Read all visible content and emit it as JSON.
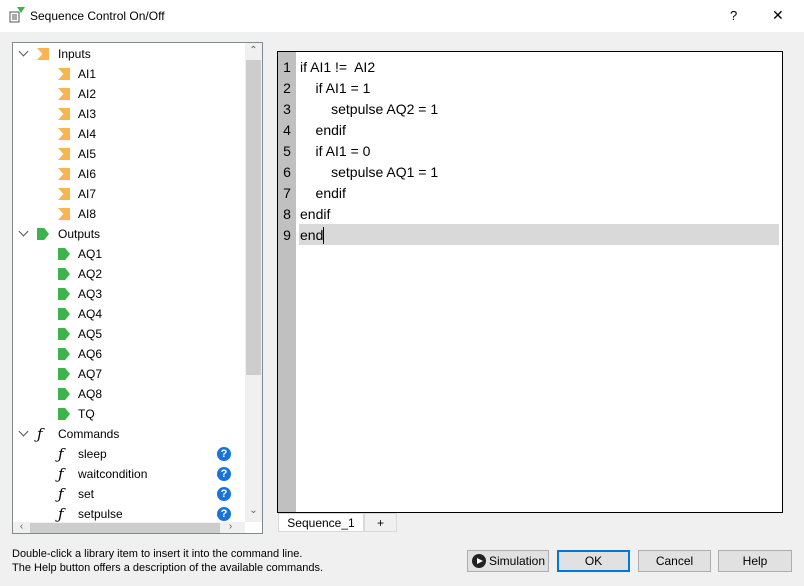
{
  "window": {
    "title": "Sequence Control On/Off",
    "help_glyph": "?",
    "close_glyph": "✕"
  },
  "tree": {
    "inputs": {
      "label": "Inputs",
      "items": [
        "AI1",
        "AI2",
        "AI3",
        "AI4",
        "AI5",
        "AI6",
        "AI7",
        "AI8"
      ]
    },
    "outputs": {
      "label": "Outputs",
      "items": [
        "AQ1",
        "AQ2",
        "AQ3",
        "AQ4",
        "AQ5",
        "AQ6",
        "AQ7",
        "AQ8",
        "TQ"
      ]
    },
    "commands": {
      "label": "Commands",
      "items": [
        "sleep",
        "waitcondition",
        "set",
        "setpulse"
      ],
      "help_glyph": "?"
    },
    "icon_colors": {
      "input": "#f8b552",
      "output": "#3cb44b",
      "help": "#1a73d6"
    }
  },
  "editor": {
    "lines": [
      "if AI1 !=  AI2",
      "    if AI1 = 1",
      "        setpulse AQ2 = 1",
      "    endif",
      "    if AI1 = 0",
      "        setpulse AQ1 = 1",
      "    endif",
      "endif",
      "end"
    ],
    "current_line": 9
  },
  "tabs": {
    "items": [
      "Sequence_1"
    ],
    "add_label": "+"
  },
  "help_text": [
    "Double-click a library item to insert it into the command line.",
    "The Help button offers a description of the available commands."
  ],
  "buttons": {
    "simulation": "Simulation",
    "ok": "OK",
    "cancel": "Cancel",
    "help": "Help"
  }
}
